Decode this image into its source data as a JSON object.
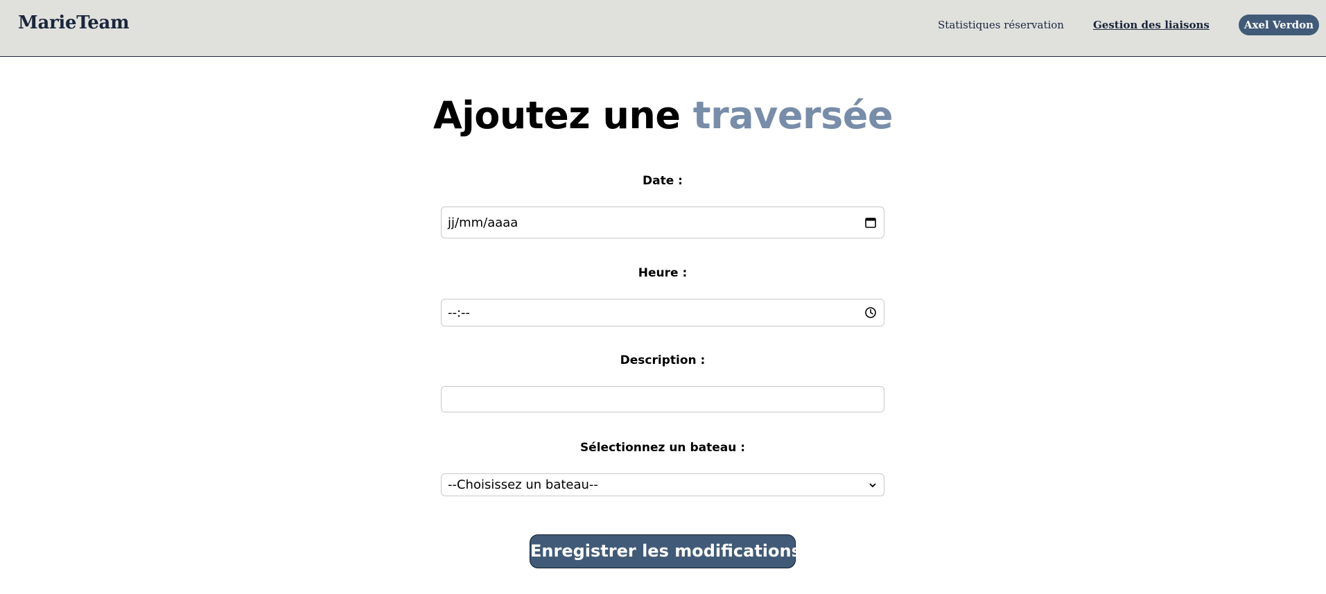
{
  "header": {
    "brand": "MarieTeam",
    "nav": {
      "stats_label": "Statistiques réservation",
      "links_label": "Gestion des liaisons",
      "user_label": "Axel Verdon"
    }
  },
  "main": {
    "title_main": "Ajoutez une",
    "title_accent": "traversée",
    "form": {
      "date_label": "Date :",
      "date_placeholder": "jj/mm/aaaa",
      "hour_label": "Heure :",
      "hour_placeholder": "--:--",
      "description_label": "Description :",
      "description_value": "",
      "boat_label": "Sélectionnez un bateau :",
      "boat_selected": "--Choisissez un bateau--",
      "submit_label": "Enregistrer les modifications"
    }
  },
  "icons": {
    "date": "calendar-icon",
    "hour": "clock-icon",
    "select": "chevron-down-icon"
  },
  "colors": {
    "navbar_bg": "#e0e1dd",
    "brand": "#1b263b",
    "accent": "#778da9",
    "button_bg": "#415a77"
  }
}
